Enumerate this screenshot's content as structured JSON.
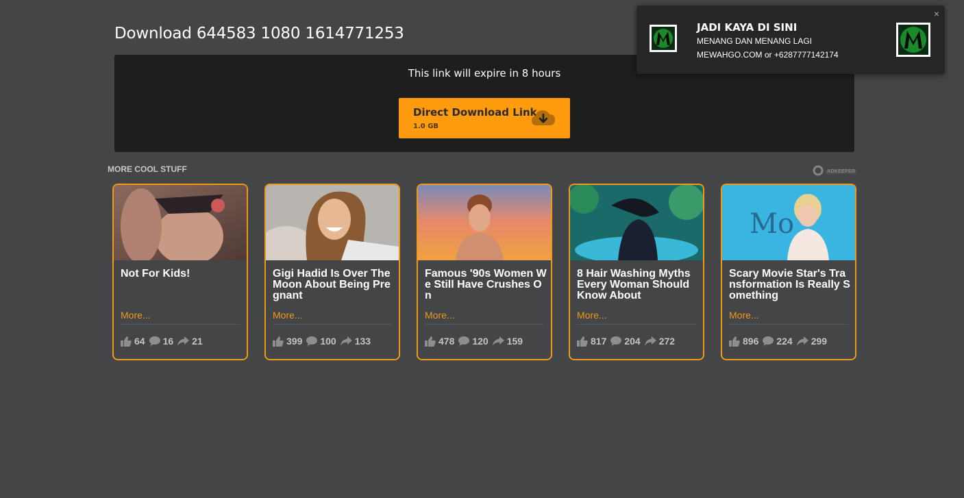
{
  "page": {
    "title": "Download 644583 1080 1614771253"
  },
  "download": {
    "expire_text": "This link will expire in 8 hours",
    "button_label": "Direct Download Link",
    "file_size": "1.0 GB",
    "accent_color": "#ff9b0f"
  },
  "related": {
    "heading": "MORE COOL STUFF",
    "badge_text": "ADKEEPER",
    "cards": [
      {
        "title": "Not For Kids!",
        "more": "More...",
        "likes": "64",
        "comments": "16",
        "shares": "21"
      },
      {
        "title": "Gigi Hadid Is Over The Moon About Being Pregnant",
        "more": "More...",
        "likes": "399",
        "comments": "100",
        "shares": "133"
      },
      {
        "title": "Famous '90s Women We Still Have Crushes On",
        "more": "More...",
        "likes": "478",
        "comments": "120",
        "shares": "159"
      },
      {
        "title": "8 Hair Washing Myths Every Woman Should Know About",
        "more": "More...",
        "likes": "817",
        "comments": "204",
        "shares": "272"
      },
      {
        "title": "Scary Movie Star's Transformation Is Really Something",
        "more": "More...",
        "likes": "896",
        "comments": "224",
        "shares": "299"
      }
    ],
    "card_border_color": "#f09a1a"
  },
  "notification": {
    "title": "JADI KAYA DI SINI",
    "subtitle": "MENANG DAN MENANG LAGI",
    "contact": "MEWAHGO.COM or +6287777142174",
    "close_icon": "×"
  }
}
